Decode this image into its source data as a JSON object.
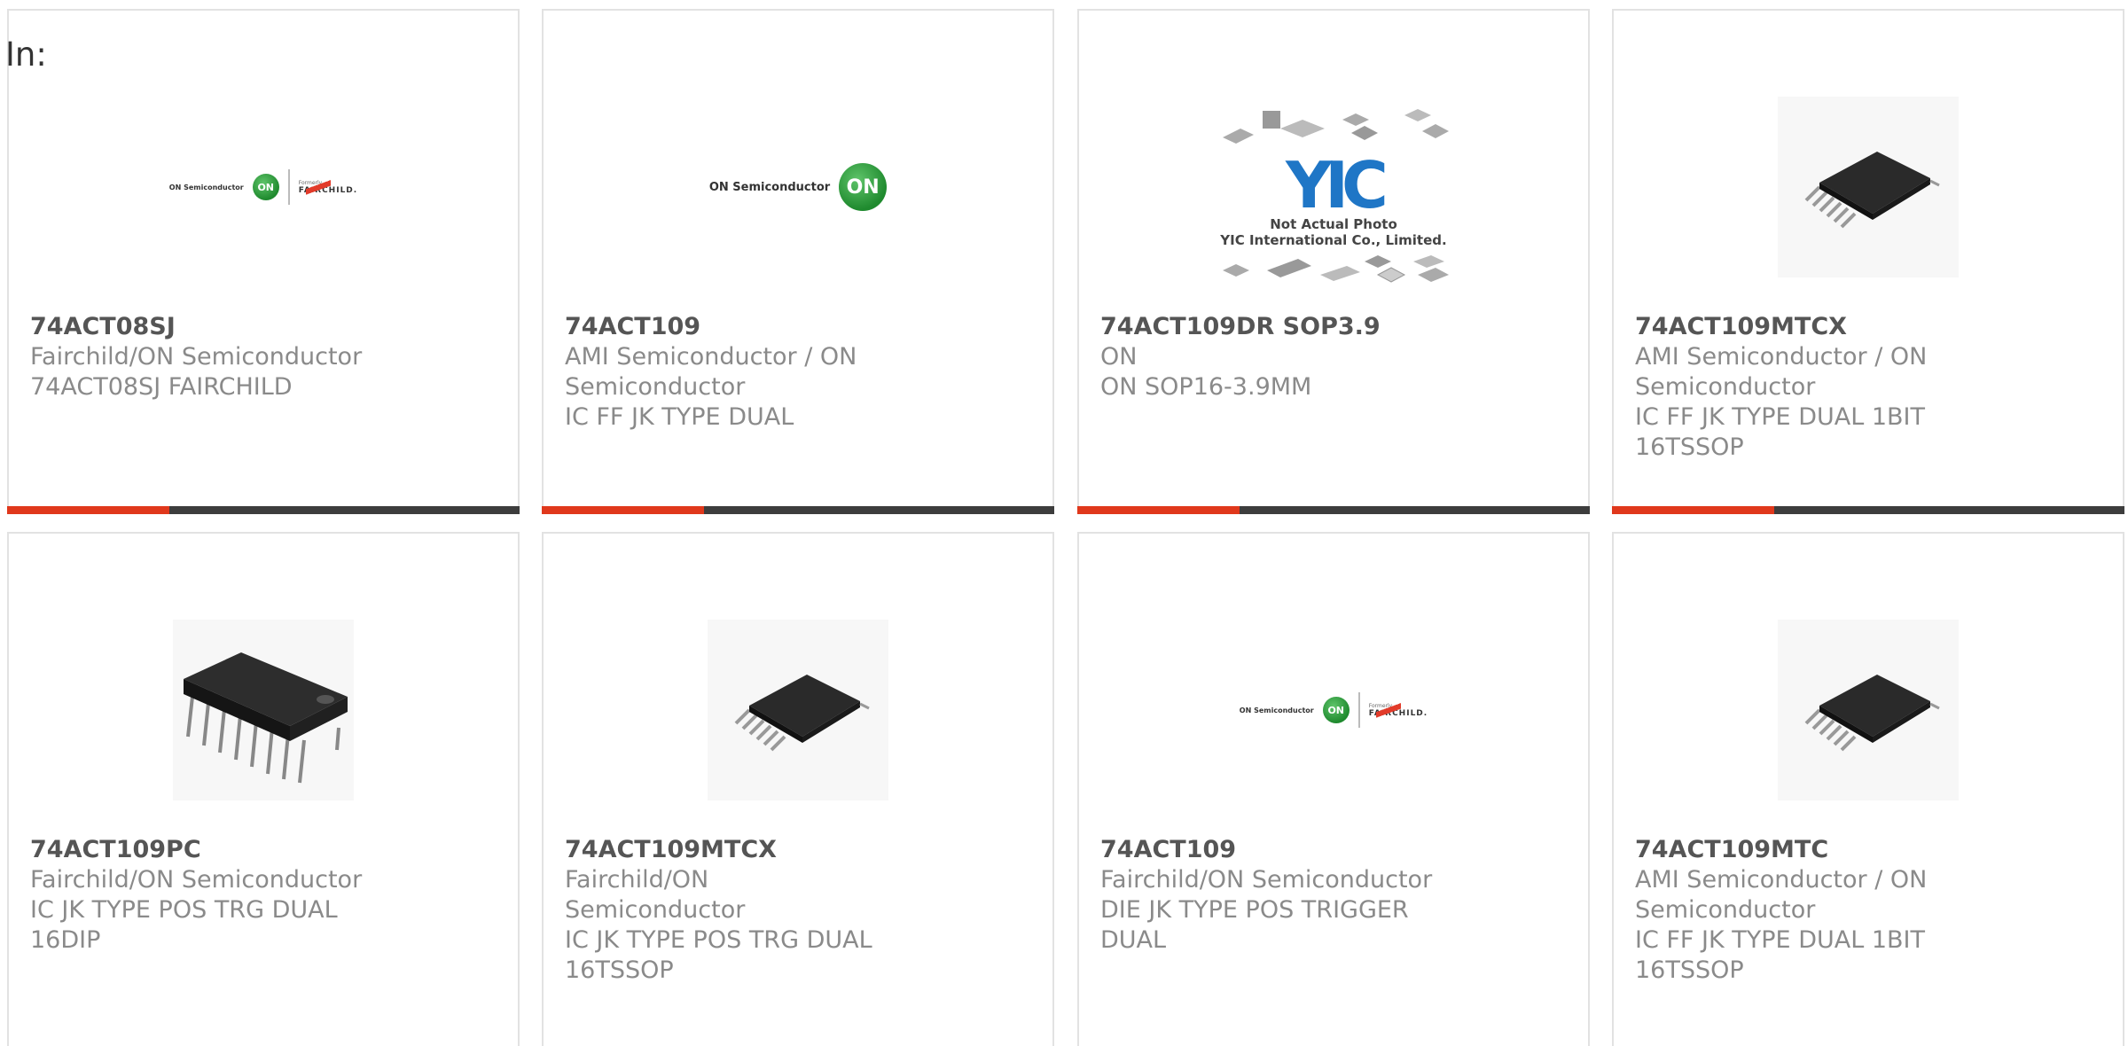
{
  "prefix_label": "In:",
  "colors": {
    "accent": "#e0381c",
    "bar_dark": "#3d3d3d",
    "border": "#e2e2e2",
    "title_text": "#555555",
    "body_text": "#8a8a8a"
  },
  "products": [
    {
      "title": "74ACT08SJ",
      "manufacturer": "Fairchild/ON Semiconductor",
      "description": "74ACT08SJ FAIRCHILD",
      "image": "on-fairchild-logo",
      "logo_text": "ON Semiconductor",
      "logo_badge": "ON",
      "logo_formerly": "Formerly",
      "logo_brand": "FAIRCHILD."
    },
    {
      "title": "74ACT109",
      "manufacturer": "AMI Semiconductor / ON Semiconductor",
      "description": "IC FF JK TYPE DUAL",
      "image": "on-semiconductor-logo",
      "logo_text": "ON Semiconductor",
      "logo_badge": "ON"
    },
    {
      "title": "74ACT109DR SOP3.9",
      "manufacturer": "ON",
      "description": "ON SOP16-3.9MM",
      "image": "yic-placeholder",
      "logo_text": "YIC",
      "caption_1": "Not Actual Photo",
      "caption_2": "YIC International Co., Limited."
    },
    {
      "title": "74ACT109MTCX",
      "manufacturer": "AMI Semiconductor / ON Semiconductor",
      "description": "IC FF JK TYPE DUAL 1BIT 16TSSOP",
      "image": "tssop-chip-photo"
    },
    {
      "title": "74ACT109PC",
      "manufacturer": "Fairchild/ON Semiconductor",
      "description": "IC JK TYPE POS TRG DUAL 16DIP",
      "image": "dip-chip-photo"
    },
    {
      "title": "74ACT109MTCX",
      "manufacturer": "Fairchild/ON Semiconductor",
      "description": "IC JK TYPE POS TRG DUAL 16TSSOP",
      "image": "tssop-chip-photo"
    },
    {
      "title": "74ACT109",
      "manufacturer": "Fairchild/ON Semiconductor",
      "description": "DIE JK TYPE POS TRIGGER DUAL",
      "image": "on-fairchild-logo",
      "logo_text": "ON Semiconductor",
      "logo_badge": "ON",
      "logo_formerly": "Formerly",
      "logo_brand": "FAIRCHILD."
    },
    {
      "title": "74ACT109MTC",
      "manufacturer": "AMI Semiconductor / ON Semiconductor",
      "description": "IC FF JK TYPE DUAL 1BIT 16TSSOP",
      "image": "tssop-chip-photo"
    }
  ]
}
